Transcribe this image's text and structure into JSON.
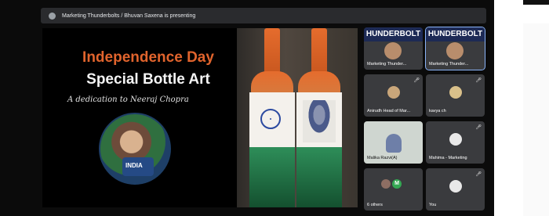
{
  "meeting": {
    "presenting_text": "Marketing Thunderbolts / Bhuvan Saxena is presenting"
  },
  "slide": {
    "title_line1": "Independence Day",
    "title_line2": "Special Bottle Art",
    "subtitle": "A dedication to Neeraj Chopra",
    "jersey_text": "INDIA"
  },
  "participants": [
    {
      "name": "Marketing Thunder...",
      "banner": "HUNDERBOLT"
    },
    {
      "name": "Marketing Thunder...",
      "banner": "HUNDERBOLT"
    },
    {
      "name": "Anirudh Head of Mar..."
    },
    {
      "name": "kavya ch"
    },
    {
      "name": "Malika Razvi(A)"
    },
    {
      "name": "Mahima - Marketing"
    },
    {
      "name": "6 others",
      "initial": "M"
    },
    {
      "name": "You"
    }
  ],
  "colors": {
    "accent_orange": "#e1642d",
    "meet_tile": "#3a3b3e",
    "avatar_green": "#34a853"
  }
}
